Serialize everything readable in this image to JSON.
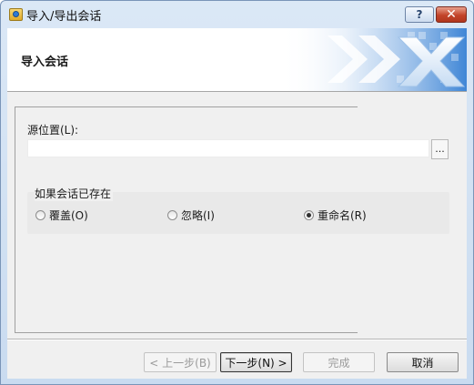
{
  "window": {
    "title": "导入/导出会话",
    "help_label": "?",
    "close_label": "✕"
  },
  "banner": {
    "heading": "导入会话"
  },
  "source": {
    "label": "源位置(L):",
    "value": "",
    "browse_label": "..."
  },
  "exists_group": {
    "title": "如果会话已存在",
    "options": [
      {
        "label": "覆盖(O)",
        "checked": false
      },
      {
        "label": "忽略(I)",
        "checked": false
      },
      {
        "label": "重命名(R)",
        "checked": true
      }
    ]
  },
  "buttons": {
    "back": "< 上一步(B)",
    "next": "下一步(N) >",
    "finish": "完成",
    "cancel": "取消"
  },
  "colors": {
    "title_bar": "#c9dbf0",
    "close_button": "#c3442a",
    "banner_art": "#2f73c9"
  }
}
